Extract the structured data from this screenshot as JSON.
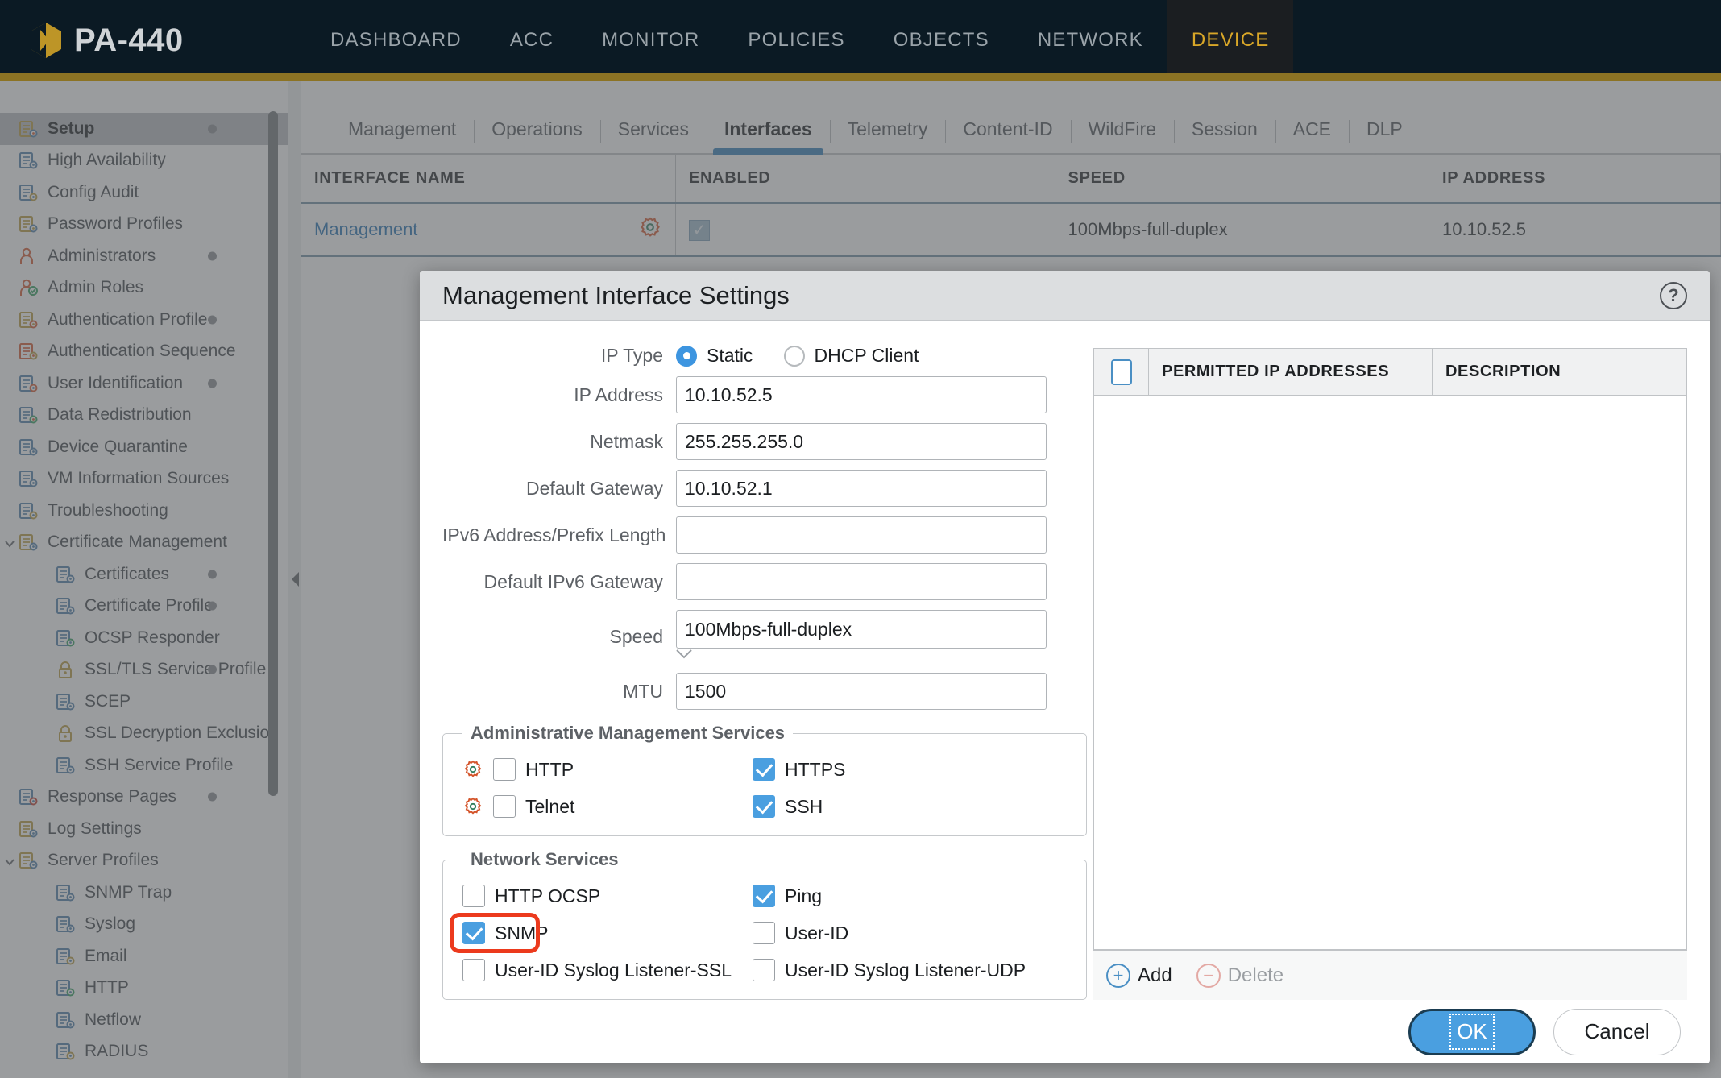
{
  "header": {
    "product": "PA-440",
    "logo_icon": "palo-alto-hex-logo",
    "nav": [
      {
        "label": "DASHBOARD",
        "active": false
      },
      {
        "label": "ACC",
        "active": false
      },
      {
        "label": "MONITOR",
        "active": false
      },
      {
        "label": "POLICIES",
        "active": false
      },
      {
        "label": "OBJECTS",
        "active": false
      },
      {
        "label": "NETWORK",
        "active": false
      },
      {
        "label": "DEVICE",
        "active": true
      }
    ],
    "accent_color": "#8c7324",
    "active_nav_color": "#d9a728",
    "bar_color": "#0b1a24"
  },
  "sidebar": {
    "items": [
      {
        "label": "Setup",
        "level": 1,
        "selected": true,
        "dot": true,
        "caret": "",
        "icon": "setup-folder-icon"
      },
      {
        "label": "High Availability",
        "level": 1,
        "selected": false,
        "dot": false,
        "caret": "",
        "icon": "ha-icon"
      },
      {
        "label": "Config Audit",
        "level": 1,
        "selected": false,
        "dot": false,
        "caret": "",
        "icon": "config-audit-icon"
      },
      {
        "label": "Password Profiles",
        "level": 1,
        "selected": false,
        "dot": false,
        "caret": "",
        "icon": "password-profiles-icon"
      },
      {
        "label": "Administrators",
        "level": 1,
        "selected": false,
        "dot": true,
        "caret": "",
        "icon": "administrators-icon"
      },
      {
        "label": "Admin Roles",
        "level": 1,
        "selected": false,
        "dot": false,
        "caret": "",
        "icon": "admin-roles-icon"
      },
      {
        "label": "Authentication Profile",
        "level": 1,
        "selected": false,
        "dot": true,
        "caret": "",
        "icon": "auth-profile-icon"
      },
      {
        "label": "Authentication Sequence",
        "level": 1,
        "selected": false,
        "dot": false,
        "caret": "",
        "icon": "auth-sequence-icon"
      },
      {
        "label": "User Identification",
        "level": 1,
        "selected": false,
        "dot": true,
        "caret": "",
        "icon": "user-identification-icon"
      },
      {
        "label": "Data Redistribution",
        "level": 1,
        "selected": false,
        "dot": false,
        "caret": "",
        "icon": "data-redistribution-icon"
      },
      {
        "label": "Device Quarantine",
        "level": 1,
        "selected": false,
        "dot": false,
        "caret": "",
        "icon": "device-quarantine-icon"
      },
      {
        "label": "VM Information Sources",
        "level": 1,
        "selected": false,
        "dot": false,
        "caret": "",
        "icon": "vm-info-sources-icon"
      },
      {
        "label": "Troubleshooting",
        "level": 1,
        "selected": false,
        "dot": false,
        "caret": "",
        "icon": "troubleshooting-icon"
      },
      {
        "label": "Certificate Management",
        "level": 1,
        "selected": false,
        "dot": false,
        "caret": "expanded",
        "icon": "certificate-management-icon"
      },
      {
        "label": "Certificates",
        "level": 2,
        "selected": false,
        "dot": true,
        "caret": "",
        "icon": "certificate-icon"
      },
      {
        "label": "Certificate Profile",
        "level": 2,
        "selected": false,
        "dot": true,
        "caret": "",
        "icon": "certificate-icon"
      },
      {
        "label": "OCSP Responder",
        "level": 2,
        "selected": false,
        "dot": false,
        "caret": "",
        "icon": "ocsp-responder-icon"
      },
      {
        "label": "SSL/TLS Service Profile",
        "level": 2,
        "selected": false,
        "dot": true,
        "caret": "",
        "icon": "lock-icon"
      },
      {
        "label": "SCEP",
        "level": 2,
        "selected": false,
        "dot": false,
        "caret": "",
        "icon": "scep-icon"
      },
      {
        "label": "SSL Decryption Exclusion",
        "level": 2,
        "selected": false,
        "dot": false,
        "caret": "",
        "icon": "lock-icon"
      },
      {
        "label": "SSH Service Profile",
        "level": 2,
        "selected": false,
        "dot": false,
        "caret": "",
        "icon": "certificate-icon"
      },
      {
        "label": "Response Pages",
        "level": 1,
        "selected": false,
        "dot": true,
        "caret": "",
        "icon": "response-pages-icon"
      },
      {
        "label": "Log Settings",
        "level": 1,
        "selected": false,
        "dot": false,
        "caret": "",
        "icon": "log-settings-icon"
      },
      {
        "label": "Server Profiles",
        "level": 1,
        "selected": false,
        "dot": false,
        "caret": "expanded",
        "icon": "server-profiles-icon"
      },
      {
        "label": "SNMP Trap",
        "level": 2,
        "selected": false,
        "dot": false,
        "caret": "",
        "icon": "server-icon"
      },
      {
        "label": "Syslog",
        "level": 2,
        "selected": false,
        "dot": false,
        "caret": "",
        "icon": "server-icon"
      },
      {
        "label": "Email",
        "level": 2,
        "selected": false,
        "dot": false,
        "caret": "",
        "icon": "email-icon"
      },
      {
        "label": "HTTP",
        "level": 2,
        "selected": false,
        "dot": false,
        "caret": "",
        "icon": "http-icon"
      },
      {
        "label": "Netflow",
        "level": 2,
        "selected": false,
        "dot": false,
        "caret": "",
        "icon": "server-icon"
      },
      {
        "label": "RADIUS",
        "level": 2,
        "selected": false,
        "dot": false,
        "caret": "",
        "icon": "radius-icon"
      }
    ]
  },
  "main": {
    "tabs": [
      {
        "label": "Management",
        "active": false
      },
      {
        "label": "Operations",
        "active": false
      },
      {
        "label": "Services",
        "active": false
      },
      {
        "label": "Interfaces",
        "active": true
      },
      {
        "label": "Telemetry",
        "active": false
      },
      {
        "label": "Content-ID",
        "active": false
      },
      {
        "label": "WildFire",
        "active": false
      },
      {
        "label": "Session",
        "active": false
      },
      {
        "label": "ACE",
        "active": false
      },
      {
        "label": "DLP",
        "active": false
      }
    ],
    "table": {
      "columns": [
        "INTERFACE NAME",
        "ENABLED",
        "SPEED",
        "IP ADDRESS"
      ],
      "rows": [
        {
          "interface_name": "Management",
          "gear_icon": "gear-icon",
          "enabled": true,
          "speed": "100Mbps-full-duplex",
          "ip_address": "10.10.52.5"
        }
      ]
    }
  },
  "dialog": {
    "title": "Management Interface Settings",
    "help_icon": "question-mark-icon",
    "ip_type": {
      "label": "IP Type",
      "options": [
        {
          "label": "Static",
          "selected": true
        },
        {
          "label": "DHCP Client",
          "selected": false
        }
      ]
    },
    "fields": [
      {
        "label": "IP Address",
        "value": "10.10.52.5",
        "placeholder": "",
        "type": "text"
      },
      {
        "label": "Netmask",
        "value": "255.255.255.0",
        "placeholder": "",
        "type": "text"
      },
      {
        "label": "Default Gateway",
        "value": "10.10.52.1",
        "placeholder": "",
        "type": "text"
      },
      {
        "label": "IPv6 Address/Prefix Length",
        "value": "",
        "placeholder": "",
        "type": "text"
      },
      {
        "label": "Default IPv6 Gateway",
        "value": "",
        "placeholder": "",
        "type": "text"
      }
    ],
    "speed": {
      "label": "Speed",
      "value": "100Mbps-full-duplex"
    },
    "mtu": {
      "label": "MTU",
      "value": "1500"
    },
    "admin_services": {
      "legend": "Administrative Management Services",
      "items": [
        {
          "label": "HTTP",
          "checked": false,
          "warn_icon": "gear-warning-icon",
          "col": 1
        },
        {
          "label": "HTTPS",
          "checked": true,
          "warn_icon": "",
          "col": 2
        },
        {
          "label": "Telnet",
          "checked": false,
          "warn_icon": "gear-warning-icon",
          "col": 1
        },
        {
          "label": "SSH",
          "checked": true,
          "warn_icon": "",
          "col": 2
        }
      ]
    },
    "network_services": {
      "legend": "Network Services",
      "items": [
        {
          "label": "HTTP OCSP",
          "checked": false,
          "highlighted": false,
          "col": 1
        },
        {
          "label": "Ping",
          "checked": true,
          "highlighted": false,
          "col": 2
        },
        {
          "label": "SNMP",
          "checked": true,
          "highlighted": true,
          "col": 1
        },
        {
          "label": "User-ID",
          "checked": false,
          "highlighted": false,
          "col": 2
        },
        {
          "label": "User-ID Syslog Listener-SSL",
          "checked": false,
          "highlighted": false,
          "col": 1
        },
        {
          "label": "User-ID Syslog Listener-UDP",
          "checked": false,
          "highlighted": false,
          "col": 2
        }
      ],
      "highlight_color": "#ec3a1d"
    },
    "permitted": {
      "columns": [
        "PERMITTED IP ADDRESSES",
        "DESCRIPTION"
      ],
      "rows": [],
      "add_label": "Add",
      "delete_label": "Delete",
      "add_icon": "plus-circle-icon",
      "delete_icon": "minus-circle-icon"
    },
    "buttons": {
      "ok": "OK",
      "cancel": "Cancel",
      "ok_color": "#4a9fe0"
    }
  }
}
